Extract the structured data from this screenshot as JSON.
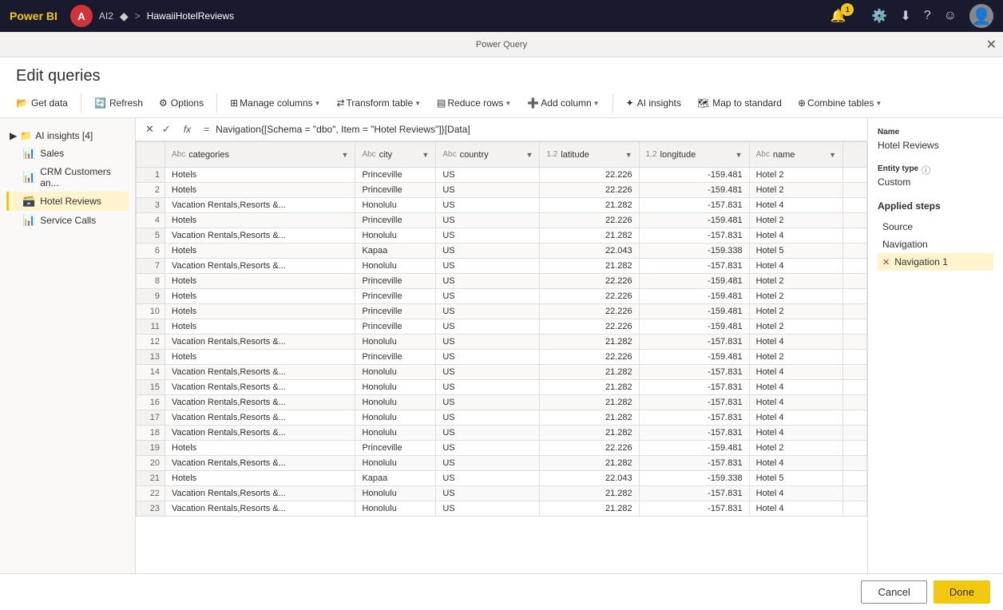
{
  "topbar": {
    "logo": "Power BI",
    "avatar_initials": "A",
    "tag": "AI2",
    "breadcrumb_separator": ">",
    "current_file": "HawaiiHotelReviews",
    "notification_count": "1"
  },
  "modal_header": "Power Query",
  "modal_close": "✕",
  "edit_queries_title": "Edit queries",
  "toolbar": {
    "get_data": "Get data",
    "refresh": "Refresh",
    "options": "Options",
    "manage_columns": "Manage columns",
    "transform_table": "Transform table",
    "reduce_rows": "Reduce rows",
    "add_column": "Add column",
    "ai_insights": "AI insights",
    "map_to_standard": "Map to standard",
    "combine_tables": "Combine tables"
  },
  "queries": {
    "group_name": "AI insights [4]",
    "items": [
      {
        "label": "Sales",
        "icon": "📊",
        "type": "table"
      },
      {
        "label": "CRM Customers an...",
        "icon": "📊",
        "type": "table"
      },
      {
        "label": "Hotel Reviews",
        "icon": "🗃️",
        "type": "table",
        "active": true
      },
      {
        "label": "Service Calls",
        "icon": "📊",
        "type": "table"
      }
    ]
  },
  "formula_bar": {
    "value": "Navigation{[Schema = \"dbo\", Item = \"Hotel Reviews\"]}[Data]"
  },
  "table": {
    "columns": [
      {
        "name": "categories",
        "type": "ABC",
        "type_icon": "Abc"
      },
      {
        "name": "city",
        "type": "ABC",
        "type_icon": "Abc"
      },
      {
        "name": "country",
        "type": "ABC",
        "type_icon": "Abc"
      },
      {
        "name": "latitude",
        "type": "1.2",
        "type_icon": "1.2"
      },
      {
        "name": "longitude",
        "type": "1.2",
        "type_icon": "1.2"
      },
      {
        "name": "name",
        "type": "ABC",
        "type_icon": "Abc"
      }
    ],
    "rows": [
      {
        "num": "1",
        "categories": "Hotels",
        "city": "Princeville",
        "country": "US",
        "latitude": "22.226",
        "longitude": "-159.481",
        "name": "Hotel 2"
      },
      {
        "num": "2",
        "categories": "Hotels",
        "city": "Princeville",
        "country": "US",
        "latitude": "22.226",
        "longitude": "-159.481",
        "name": "Hotel 2"
      },
      {
        "num": "3",
        "categories": "Vacation Rentals,Resorts &...",
        "city": "Honolulu",
        "country": "US",
        "latitude": "21.282",
        "longitude": "-157.831",
        "name": "Hotel 4"
      },
      {
        "num": "4",
        "categories": "Hotels",
        "city": "Princeville",
        "country": "US",
        "latitude": "22.226",
        "longitude": "-159.481",
        "name": "Hotel 2"
      },
      {
        "num": "5",
        "categories": "Vacation Rentals,Resorts &...",
        "city": "Honolulu",
        "country": "US",
        "latitude": "21.282",
        "longitude": "-157.831",
        "name": "Hotel 4"
      },
      {
        "num": "6",
        "categories": "Hotels",
        "city": "Kapaa",
        "country": "US",
        "latitude": "22.043",
        "longitude": "-159.338",
        "name": "Hotel 5"
      },
      {
        "num": "7",
        "categories": "Vacation Rentals,Resorts &...",
        "city": "Honolulu",
        "country": "US",
        "latitude": "21.282",
        "longitude": "-157.831",
        "name": "Hotel 4"
      },
      {
        "num": "8",
        "categories": "Hotels",
        "city": "Princeville",
        "country": "US",
        "latitude": "22.226",
        "longitude": "-159.481",
        "name": "Hotel 2"
      },
      {
        "num": "9",
        "categories": "Hotels",
        "city": "Princeville",
        "country": "US",
        "latitude": "22.226",
        "longitude": "-159.481",
        "name": "Hotel 2"
      },
      {
        "num": "10",
        "categories": "Hotels",
        "city": "Princeville",
        "country": "US",
        "latitude": "22.226",
        "longitude": "-159.481",
        "name": "Hotel 2"
      },
      {
        "num": "11",
        "categories": "Hotels",
        "city": "Princeville",
        "country": "US",
        "latitude": "22.226",
        "longitude": "-159.481",
        "name": "Hotel 2"
      },
      {
        "num": "12",
        "categories": "Vacation Rentals,Resorts &...",
        "city": "Honolulu",
        "country": "US",
        "latitude": "21.282",
        "longitude": "-157.831",
        "name": "Hotel 4"
      },
      {
        "num": "13",
        "categories": "Hotels",
        "city": "Princeville",
        "country": "US",
        "latitude": "22.226",
        "longitude": "-159.481",
        "name": "Hotel 2"
      },
      {
        "num": "14",
        "categories": "Vacation Rentals,Resorts &...",
        "city": "Honolulu",
        "country": "US",
        "latitude": "21.282",
        "longitude": "-157.831",
        "name": "Hotel 4"
      },
      {
        "num": "15",
        "categories": "Vacation Rentals,Resorts &...",
        "city": "Honolulu",
        "country": "US",
        "latitude": "21.282",
        "longitude": "-157.831",
        "name": "Hotel 4"
      },
      {
        "num": "16",
        "categories": "Vacation Rentals,Resorts &...",
        "city": "Honolulu",
        "country": "US",
        "latitude": "21.282",
        "longitude": "-157.831",
        "name": "Hotel 4"
      },
      {
        "num": "17",
        "categories": "Vacation Rentals,Resorts &...",
        "city": "Honolulu",
        "country": "US",
        "latitude": "21.282",
        "longitude": "-157.831",
        "name": "Hotel 4"
      },
      {
        "num": "18",
        "categories": "Vacation Rentals,Resorts &...",
        "city": "Honolulu",
        "country": "US",
        "latitude": "21.282",
        "longitude": "-157.831",
        "name": "Hotel 4"
      },
      {
        "num": "19",
        "categories": "Hotels",
        "city": "Princeville",
        "country": "US",
        "latitude": "22.226",
        "longitude": "-159.481",
        "name": "Hotel 2"
      },
      {
        "num": "20",
        "categories": "Vacation Rentals,Resorts &...",
        "city": "Honolulu",
        "country": "US",
        "latitude": "21.282",
        "longitude": "-157.831",
        "name": "Hotel 4"
      },
      {
        "num": "21",
        "categories": "Hotels",
        "city": "Kapaa",
        "country": "US",
        "latitude": "22.043",
        "longitude": "-159.338",
        "name": "Hotel 5"
      },
      {
        "num": "22",
        "categories": "Vacation Rentals,Resorts &...",
        "city": "Honolulu",
        "country": "US",
        "latitude": "21.282",
        "longitude": "-157.831",
        "name": "Hotel 4"
      },
      {
        "num": "23",
        "categories": "Vacation Rentals,Resorts &...",
        "city": "Honolulu",
        "country": "US",
        "latitude": "21.282",
        "longitude": "-157.831",
        "name": "Hotel 4"
      }
    ]
  },
  "right_panel": {
    "name_label": "Name",
    "name_value": "Hotel Reviews",
    "entity_type_label": "Entity type",
    "entity_type_value": "Custom",
    "applied_steps_label": "Applied steps",
    "steps": [
      {
        "label": "Source",
        "active": false,
        "deletable": false
      },
      {
        "label": "Navigation",
        "active": false,
        "deletable": false
      },
      {
        "label": "Navigation 1",
        "active": true,
        "deletable": true
      }
    ]
  },
  "footer": {
    "cancel_label": "Cancel",
    "done_label": "Done"
  }
}
